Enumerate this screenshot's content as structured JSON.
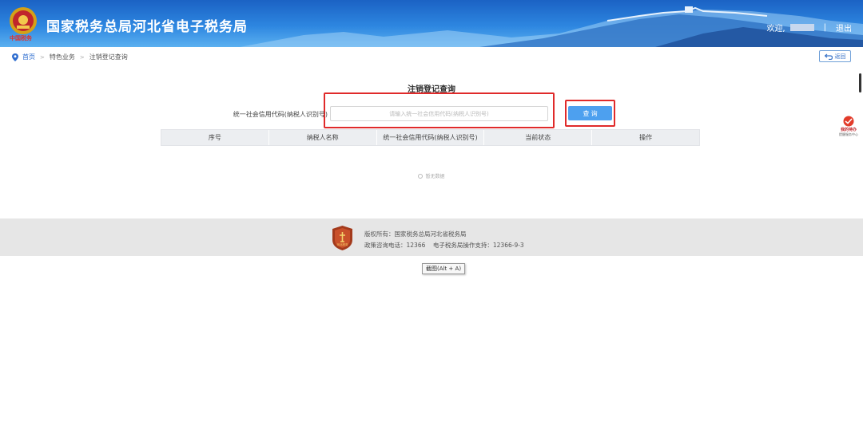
{
  "header": {
    "site_title": "国家税务总局河北省电子税务局",
    "emblem_caption": "中国税务",
    "welcome": "欢迎,",
    "separator": "|",
    "logout": "退出"
  },
  "breadcrumb": {
    "home": "首页",
    "level2": "特色业务",
    "current": "注销登记查询",
    "arrow": ">"
  },
  "back_button": {
    "label": "返回"
  },
  "main": {
    "title": "注销登记查询",
    "field_label": "统一社会信用代码(纳税人识别号)",
    "search_placeholder": "请输入统一社会信用代码(纳税人识别号)",
    "search_value": "",
    "query_label": "查 询"
  },
  "table": {
    "columns": [
      "序号",
      "纳税人名称",
      "统一社会信用代码(纳税人识别号)",
      "当前状态",
      "操作"
    ],
    "empty_text": "暂无数据"
  },
  "side_widget": {
    "title": "我的待办",
    "subtitle": "提醒服务中心"
  },
  "footer": {
    "logo_caption": "河北税务",
    "copyright": "版权所有：国家税务总局河北省税务局",
    "contact": "政策咨询电话：12366    电子税务局操作支持：12366-9-3"
  },
  "tooltip": {
    "text": "截图(Alt + A)"
  },
  "colors": {
    "header_blue": "#2d86e0",
    "primary_button": "#4da0ef",
    "highlight_red": "#e02a2a",
    "footer_gray": "#e6e6e6"
  },
  "icons": [
    "national-emblem-icon",
    "location-pin-icon",
    "back-arrow-icon",
    "empty-data-icon",
    "tax-shield-logo-icon",
    "todo-widget-icon"
  ]
}
